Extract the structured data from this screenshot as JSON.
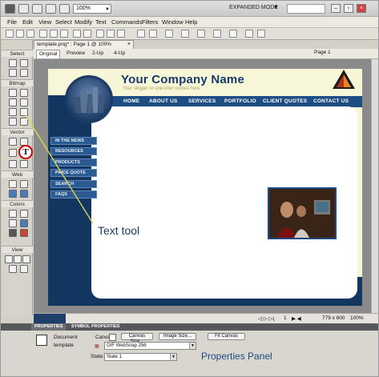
{
  "appbar": {
    "zoom": "100%",
    "mode": "EXPANDED MODE"
  },
  "menu": [
    "File",
    "Edit",
    "View",
    "Select",
    "Modify",
    "Text",
    "Commands",
    "Filters",
    "Window",
    "Help"
  ],
  "document": {
    "tab_title": "template.png* : Page 1 @ 100%",
    "views": [
      "Original",
      "Preview",
      "2-Up",
      "4-Up"
    ],
    "page": "Page 1"
  },
  "tools_panel": {
    "sections": [
      "Select",
      "Bitmap",
      "Vector",
      "Web",
      "Colors",
      "View"
    ]
  },
  "site": {
    "company": "Your Company Name",
    "slogan": "Your slogan or one-liner comes here",
    "nav": [
      "HOME",
      "ABOUT US",
      "SERVICES",
      "PORTFOLIO",
      "CLIENT QUOTES",
      "CONTACT US"
    ],
    "side": [
      "IN THE NEWS",
      "RESOURCES",
      "PRODUCTS",
      "PRICE QUOTE",
      "SEARCH",
      "FAQS"
    ]
  },
  "annotation": {
    "text_tool": "Text tool",
    "properties_panel": "Properties Panel"
  },
  "status": {
    "page_num": "1",
    "size": "779 x 600",
    "zoom": "100%"
  },
  "properties": {
    "tabs": [
      "PROPERTIES",
      "SYMBOL PROPERTIES"
    ],
    "doc_label": "Document",
    "doc_name": "template",
    "canvas_label": "Canvas:",
    "canvas_size_btn": "Canvas Size...",
    "image_size_btn": "Image Size...",
    "fit_canvas_btn": "Fit Canvas",
    "format_value": "GIF WebSnap 256",
    "state_label": "State:",
    "state_value": "State 1"
  },
  "colors": {
    "accent": "#1d4b86",
    "navy": "#12365f",
    "callout_line": "#d4d44a"
  }
}
